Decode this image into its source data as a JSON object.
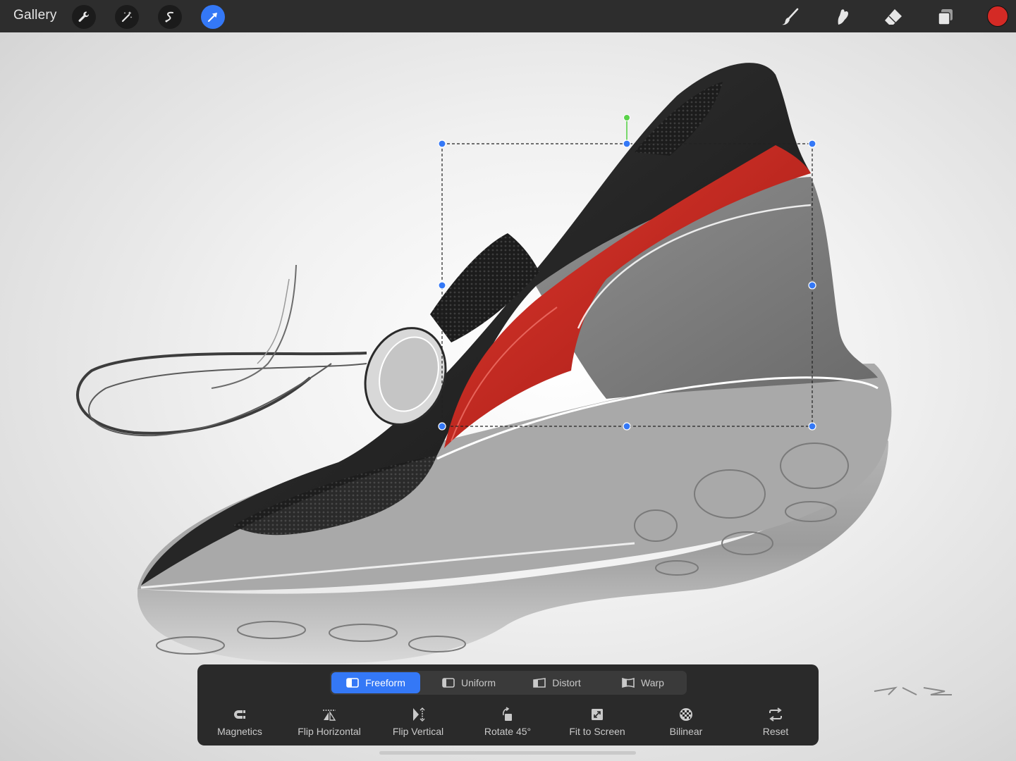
{
  "topbar": {
    "gallery_label": "Gallery",
    "left_tools": [
      {
        "name": "wrench-icon",
        "active": false
      },
      {
        "name": "magic-wand-icon",
        "active": false
      },
      {
        "name": "selection-icon",
        "active": false
      },
      {
        "name": "transform-arrow-icon",
        "active": true
      }
    ],
    "right_tools": [
      "brush-icon",
      "smudge-icon",
      "eraser-icon",
      "layers-icon"
    ],
    "current_color": "#d42a25"
  },
  "transform": {
    "modes": [
      {
        "label": "Freeform",
        "icon": "freeform-icon",
        "active": true
      },
      {
        "label": "Uniform",
        "icon": "uniform-icon",
        "active": false
      },
      {
        "label": "Distort",
        "icon": "distort-icon",
        "active": false
      },
      {
        "label": "Warp",
        "icon": "warp-icon",
        "active": false
      }
    ],
    "actions": [
      {
        "label": "Magnetics",
        "icon": "magnet-icon"
      },
      {
        "label": "Flip Horizontal",
        "icon": "flip-horizontal-icon"
      },
      {
        "label": "Flip Vertical",
        "icon": "flip-vertical-icon"
      },
      {
        "label": "Rotate 45°",
        "icon": "rotate-icon"
      },
      {
        "label": "Fit to Screen",
        "icon": "fit-screen-icon"
      },
      {
        "label": "Bilinear",
        "icon": "bilinear-icon"
      },
      {
        "label": "Reset",
        "icon": "reset-icon"
      }
    ]
  },
  "colors": {
    "accent": "#3478f6",
    "handle_rotate": "#5ad24a",
    "shoe_red": "#c8231d"
  }
}
